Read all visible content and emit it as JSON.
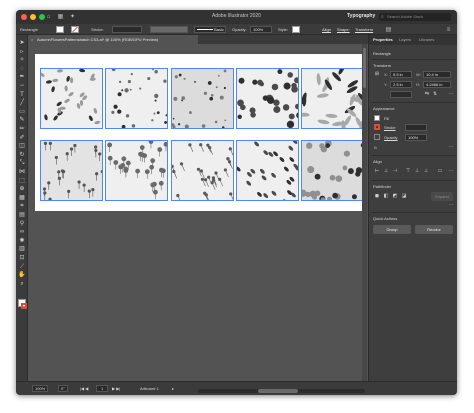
{
  "titlebar": {
    "app_title": "Adobe Illustrator 2020",
    "workspace": "Typography",
    "search_placeholder": "Search Adobe Stock",
    "traffic_light_colors": [
      "#ff5f57",
      "#febc2e",
      "#28c840"
    ],
    "icons": [
      "home-icon",
      "grid-icon",
      "gpu-icon"
    ]
  },
  "control_bar": {
    "selection_label": "Rectangle",
    "stroke_label": "Stroke:",
    "stroke_value": "",
    "brush_style": "Basic",
    "opacity_label": "Opacity:",
    "opacity_value": "100%",
    "style_label": "Style:",
    "align_label": "Align",
    "shape_label": "Shape:",
    "transform_label": "Transform"
  },
  "document_tab": {
    "title": "AutumnFlowersPatternsbatch CS3.ai* @ 100% (RGB/GPU Preview)",
    "close_symbol": "×"
  },
  "tools": [
    "selection-tool-icon",
    "direct-selection-tool-icon",
    "magic-wand-icon",
    "lasso-icon",
    "pen-tool-icon",
    "curvature-tool-icon",
    "type-tool-icon",
    "line-tool-icon",
    "rectangle-tool-icon",
    "paintbrush-icon",
    "pencil-icon",
    "shaper-icon",
    "eraser-icon",
    "rotate-tool-icon",
    "scale-tool-icon",
    "width-tool-icon",
    "free-transform-icon",
    "shape-builder-icon",
    "perspective-grid-icon",
    "mesh-tool-icon",
    "gradient-tool-icon",
    "eyedropper-icon",
    "blend-tool-icon",
    "symbol-sprayer-icon",
    "column-graph-icon",
    "artboard-tool-icon",
    "slice-tool-icon",
    "hand-tool-icon",
    "zoom-tool-icon"
  ],
  "properties_panel": {
    "tabs": [
      "Properties",
      "Layers",
      "Libraries"
    ],
    "active_tab": "Properties",
    "object_type": "Rectangle",
    "transform_heading": "Transform",
    "x_label": "X:",
    "x_value": "5.5 in",
    "y_label": "Y:",
    "y_value": "2.5 in",
    "w_label": "W:",
    "w_value": "10.4 in",
    "h_label": "H:",
    "h_value": "4.2466 in",
    "appearance_heading": "Appearance",
    "fill_label": "Fill",
    "stroke_label": "Stroke",
    "opacity_label": "Opacity",
    "opacity_value": "100%",
    "fx_label": "fx",
    "align_heading": "Align",
    "pathfinder_heading": "Pathfinder",
    "expand_label": "Expand",
    "quick_actions_heading": "Quick Actions",
    "group_button": "Group",
    "recolor_button": "Recolor",
    "stroke_color": "#e0493b"
  },
  "status_bar": {
    "zoom": "100%",
    "rotation": "0°",
    "artboard_number": "1",
    "status_text": "Artboard 1"
  },
  "colors": {
    "accent_blue": "#4f87ff",
    "canvas_gray": "#535353",
    "panel_gray": "#3e3e3e"
  }
}
